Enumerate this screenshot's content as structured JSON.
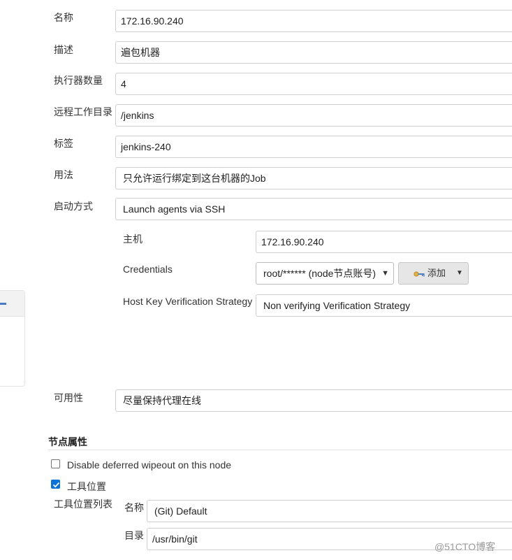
{
  "form": {
    "name_label": "名称",
    "name_value": "172.16.90.240",
    "desc_label": "描述",
    "desc_value": "遍包机器",
    "executors_label": "执行器数量",
    "executors_value": "4",
    "remote_dir_label": "远程工作目录",
    "remote_dir_value": "/jenkins",
    "labels_label": "标签",
    "labels_value": "jenkins-240",
    "usage_label": "用法",
    "usage_value": "只允许运行绑定到这台机器的Job",
    "launch_label": "启动方式",
    "launch_value": "Launch agents via SSH",
    "host_label": "主机",
    "host_value": "172.16.90.240",
    "credentials_label": "Credentials",
    "credentials_value": "root/****** (node节点账号)",
    "add_button_label": "添加",
    "hkvs_label": "Host Key Verification Strategy",
    "hkvs_value": "Non verifying Verification Strategy",
    "availability_label": "可用性",
    "availability_value": "尽量保持代理在线"
  },
  "node_properties": {
    "title": "节点属性",
    "disable_wipeout_label": "Disable deferred wipeout on this node",
    "disable_wipeout_checked": false,
    "tool_locations_label": "工具位置",
    "tool_locations_checked": true,
    "tool_list_label": "工具位置列表",
    "tool_name_label": "名称",
    "tool_name_value": "(Git) Default",
    "tool_dir_label": "目录",
    "tool_dir_value": "/usr/bin/git"
  },
  "watermark": "@51CTO博客",
  "colors": {
    "checkbox_checked": "#0b74d9",
    "side_accent": "#4a7cc3"
  }
}
